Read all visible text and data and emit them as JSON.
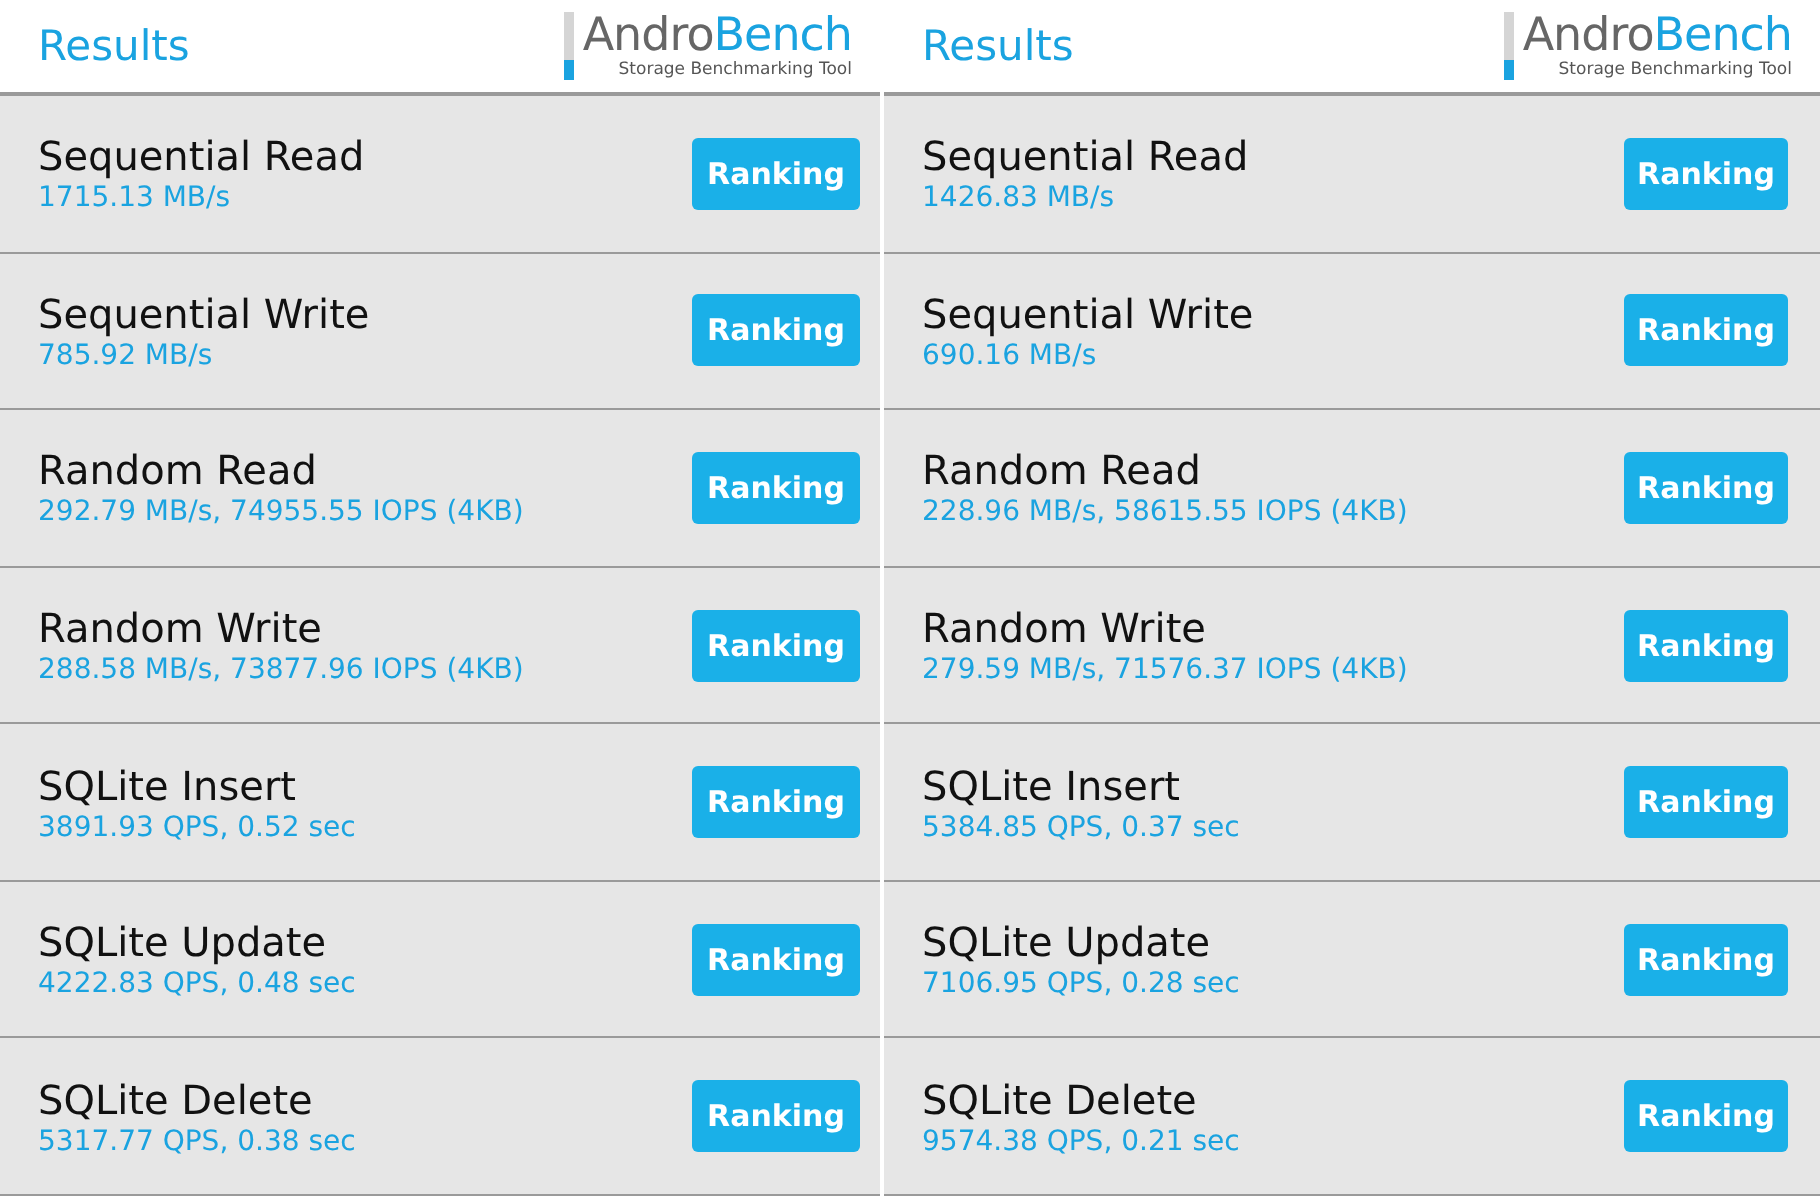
{
  "panels": [
    {
      "header": {
        "title": "Results",
        "logo_first": "Andro",
        "logo_second": "Bench",
        "tagline": "Storage Benchmarking Tool"
      },
      "results": [
        {
          "name": "Sequential Read",
          "value": "1715.13 MB/s",
          "button": "Ranking"
        },
        {
          "name": "Sequential Write",
          "value": "785.92 MB/s",
          "button": "Ranking"
        },
        {
          "name": "Random Read",
          "value": "292.79 MB/s, 74955.55 IOPS (4KB)",
          "button": "Ranking"
        },
        {
          "name": "Random Write",
          "value": "288.58 MB/s, 73877.96 IOPS (4KB)",
          "button": "Ranking"
        },
        {
          "name": "SQLite Insert",
          "value": "3891.93 QPS, 0.52 sec",
          "button": "Ranking"
        },
        {
          "name": "SQLite Update",
          "value": "4222.83 QPS, 0.48 sec",
          "button": "Ranking"
        },
        {
          "name": "SQLite Delete",
          "value": "5317.77 QPS, 0.38 sec",
          "button": "Ranking"
        }
      ]
    },
    {
      "header": {
        "title": "Results",
        "logo_first": "Andro",
        "logo_second": "Bench",
        "tagline": "Storage Benchmarking Tool"
      },
      "results": [
        {
          "name": "Sequential Read",
          "value": "1426.83 MB/s",
          "button": "Ranking"
        },
        {
          "name": "Sequential Write",
          "value": "690.16 MB/s",
          "button": "Ranking"
        },
        {
          "name": "Random Read",
          "value": "228.96 MB/s, 58615.55 IOPS (4KB)",
          "button": "Ranking"
        },
        {
          "name": "Random Write",
          "value": "279.59 MB/s, 71576.37 IOPS (4KB)",
          "button": "Ranking"
        },
        {
          "name": "SQLite Insert",
          "value": "5384.85 QPS, 0.37 sec",
          "button": "Ranking"
        },
        {
          "name": "SQLite Update",
          "value": "7106.95 QPS, 0.28 sec",
          "button": "Ranking"
        },
        {
          "name": "SQLite Delete",
          "value": "9574.38 QPS, 0.21 sec",
          "button": "Ranking"
        }
      ]
    }
  ]
}
